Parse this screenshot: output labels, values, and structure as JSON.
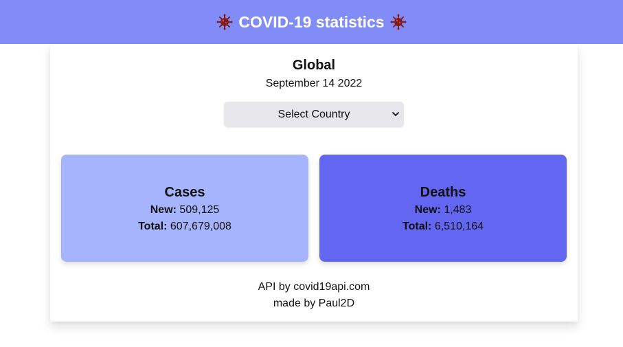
{
  "header": {
    "title": "COVID-19 statistics",
    "icon_left": "virus-icon",
    "icon_right": "virus-icon",
    "background_color": "#818cf8",
    "icon_color": "#7f1d1d"
  },
  "main": {
    "region": "Global",
    "date": "September 14 2022",
    "country_select": {
      "selected": "Select Country"
    }
  },
  "stats": {
    "cases": {
      "title": "Cases",
      "new_label": "New:",
      "new_value": "509,125",
      "total_label": "Total:",
      "total_value": "607,679,008",
      "color": "#a5b4fc"
    },
    "deaths": {
      "title": "Deaths",
      "new_label": "New:",
      "new_value": "1,483",
      "total_label": "Total:",
      "total_value": "6,510,164",
      "color": "#6366f1"
    }
  },
  "footer": {
    "api_text": "API by covid19api.com",
    "author_text": "made by Paul2D"
  }
}
